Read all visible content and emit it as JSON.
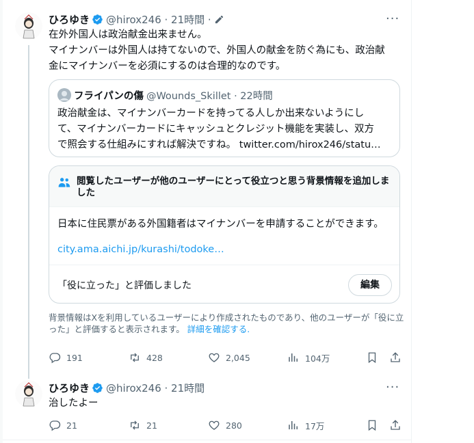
{
  "tweet1": {
    "name": "ひろゆき",
    "handle": "@hirox246",
    "time": "21時間",
    "meta": "@hirox246 · 21時間 ·",
    "text_line1": "在外外国人は政治献金出来ません。",
    "text_line2": "マイナンバーは外国人は持てないので、外国人の献金を防ぐ為にも、政治献",
    "text_line3": "金にマイナンバーを必須にするのは合理的なのです。",
    "quote": {
      "name": "フライパンの傷",
      "meta": "@Wounds_Skillet · 22時間",
      "line1": "政治献金は、マイナンバーカードを持ってる人しか出来ないようにし",
      "line2": "て、マイナンバーカードにキャッシュとクレジット機能を実装し、双方",
      "line3": "で照会する仕組みにすれば解決ですね。 twitter.com/hirox246/statu…"
    },
    "note": {
      "title": "閲覧したユーザーが他のユーザーにとって役立つと思う背景情報を追加しました",
      "body": "日本に住民票がある外国籍者はマイナンバーを申請することができます。",
      "link": "city.ama.aichi.jp/kurashi/todoke…",
      "rated": "「役に立った」と評価しました",
      "edit_label": "編集"
    },
    "disclaimer": "背景情報はXを利用しているユーザーにより作成されたものであり、他のユーザーが「役に立った」と評価すると表示されます。",
    "learn_more": "詳細を確認する.",
    "stats": {
      "replies": "191",
      "retweets": "428",
      "likes": "2,045",
      "views": "104万"
    }
  },
  "tweet2": {
    "name": "ひろゆき",
    "meta": "@hirox246 · 21時間",
    "text": "治したよー",
    "stats": {
      "replies": "21",
      "retweets": "21",
      "likes": "280",
      "views": "17万"
    }
  },
  "more_label": "···",
  "colors": {
    "accent": "#1d9bf0",
    "text": "#0f1419",
    "secondary": "#536471",
    "border": "#cfd9de"
  },
  "icons": [
    "verified-badge-icon",
    "edit-pencil-icon",
    "more-icon",
    "people-icon",
    "reply-icon",
    "retweet-icon",
    "like-icon",
    "views-icon",
    "bookmark-icon",
    "share-icon"
  ]
}
